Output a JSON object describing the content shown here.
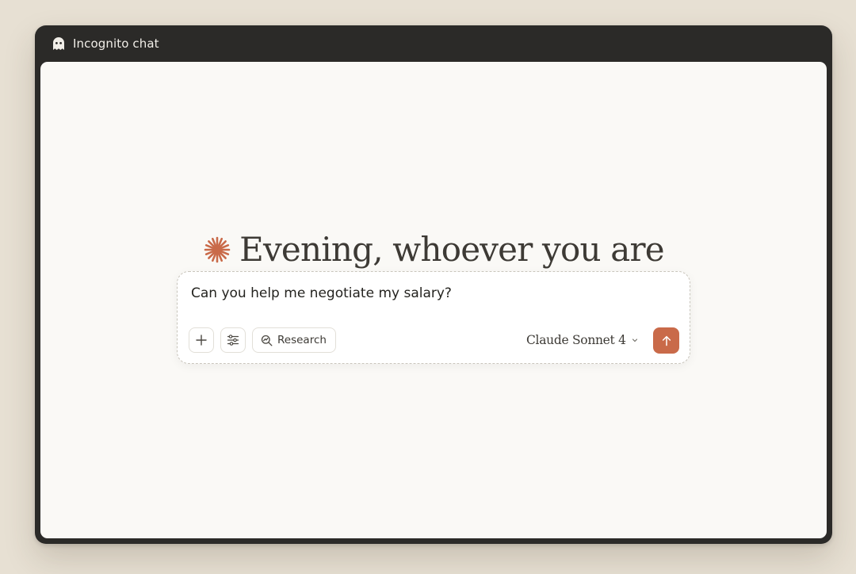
{
  "window": {
    "title": "Incognito chat",
    "title_icon": "ghost-icon"
  },
  "main": {
    "greeting": "Evening, whoever you are",
    "greeting_icon": "spark-icon",
    "accent_color": "#c96a49"
  },
  "composer": {
    "input_value": "Can you help me negotiate my salary?",
    "add_icon": "plus-icon",
    "tools_icon": "sliders-icon",
    "research_label": "Research",
    "research_icon": "research-icon",
    "model_label": "Claude Sonnet 4",
    "model_icon": "chevron-down-icon",
    "send_icon": "arrow-up-icon"
  }
}
